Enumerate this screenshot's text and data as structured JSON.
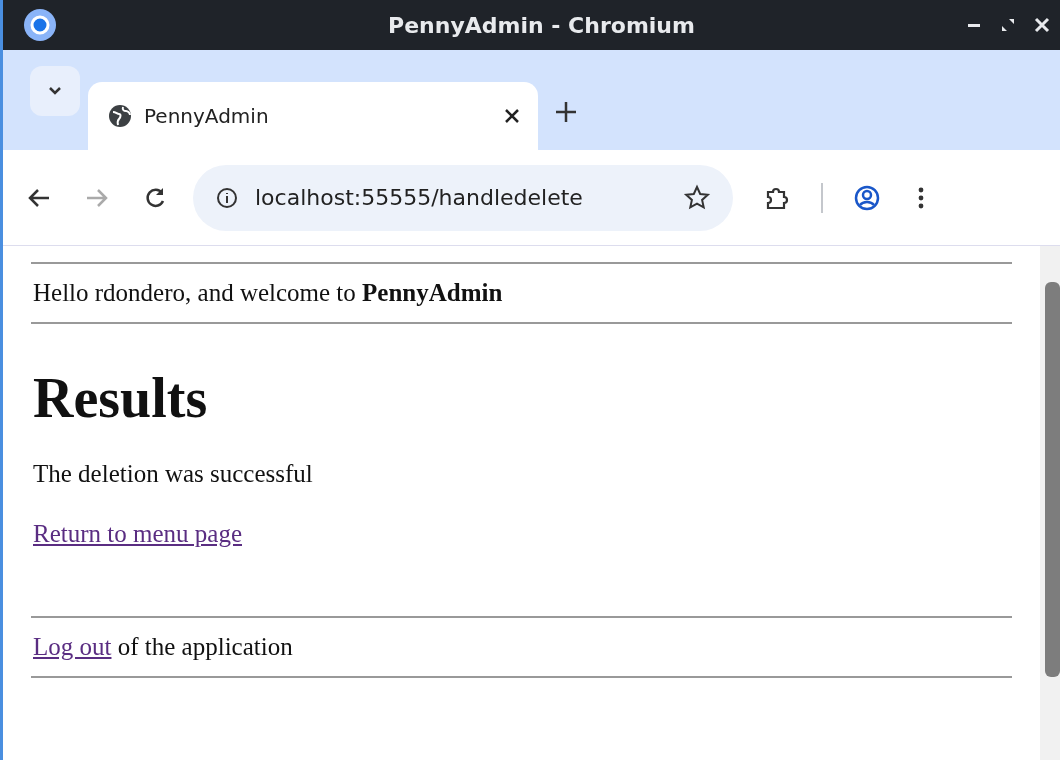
{
  "window": {
    "title": "PennyAdmin - Chromium"
  },
  "tabs": [
    {
      "label": "PennyAdmin",
      "selected": true
    }
  ],
  "address_bar": {
    "url": "localhost:55555/handledelete"
  },
  "page": {
    "greeting": "Hello rdondero, and welcome to **PennyAdmin**",
    "heading": "Results",
    "message": "The deletion was successful",
    "menu_link": "Return to menu page",
    "logout_link": "Log out",
    "logout_text": "of the application"
  }
}
